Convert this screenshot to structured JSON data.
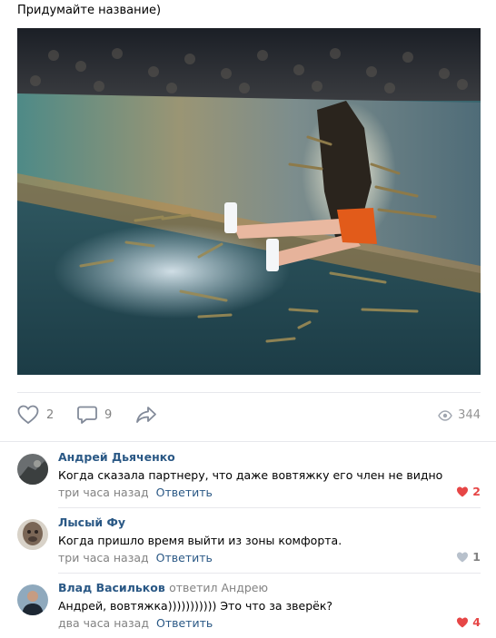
{
  "post": {
    "text": "Придумайте название)"
  },
  "actions": {
    "like_count": "2",
    "comment_count": "9",
    "views": "344",
    "like_icon": "heart-outline-icon",
    "comment_icon": "comment-bubble-icon",
    "share_icon": "share-arrow-icon",
    "views_icon": "eye-icon"
  },
  "comments": [
    {
      "author": "Андрей Дьяченко",
      "reply_to": "",
      "text": "Когда сказала партнеру, что даже вовтяжку его член не видно",
      "time": "три часа назад",
      "reply_label": "Ответить",
      "likes": "2",
      "liked": true
    },
    {
      "author": "Лысый Фу",
      "reply_to": "",
      "text": "Когда пришло время выйти из зоны комфорта.",
      "time": "три часа назад",
      "reply_label": "Ответить",
      "likes": "1",
      "liked": false
    },
    {
      "author": "Влад Васильков",
      "reply_to": "ответил Андрею",
      "text": "Андрей, вовтяжка))))))))))) Это что за зверёк?",
      "time": "два часа назад",
      "reply_label": "Ответить",
      "likes": "4",
      "liked": true
    }
  ],
  "colors": {
    "link": "#2a5885",
    "muted": "#828282",
    "liked": "#e64646",
    "unliked": "#b8c1cc"
  }
}
